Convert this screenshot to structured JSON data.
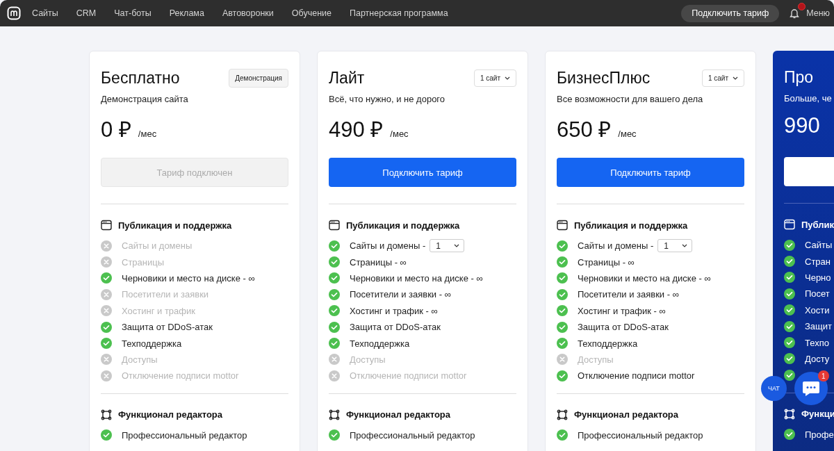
{
  "nav": {
    "items": [
      "Сайты",
      "CRM",
      "Чат-боты",
      "Реклама",
      "Автоворонки",
      "Обучение",
      "Партнерская программа"
    ],
    "cta": "Подключить тариф",
    "notification": true,
    "menu": "Меню"
  },
  "plans": [
    {
      "kind": "standard",
      "title": "Бесплатно",
      "top_control": {
        "kind": "badge",
        "label": "Демонстрация"
      },
      "subtitle": "Демонстрация сайта",
      "price": "0 ₽",
      "period": "/мес",
      "button": {
        "kind": "disabled",
        "label": "Тариф подключен"
      },
      "sections": [
        {
          "title": "Публикация и поддержка",
          "items": [
            {
              "label": "Сайты и домены",
              "included": false
            },
            {
              "label": "Страницы",
              "included": false
            },
            {
              "label": "Черновики и место на диске - ∞",
              "included": true
            },
            {
              "label": "Посетители и заявки",
              "included": false
            },
            {
              "label": "Хостинг и трафик",
              "included": false
            },
            {
              "label": "Защита от DDoS-атак",
              "included": true
            },
            {
              "label": "Техподдержка",
              "included": true
            },
            {
              "label": "Доступы",
              "included": false
            },
            {
              "label": "Отключение подписи mottor",
              "included": false
            }
          ]
        },
        {
          "title": "Функционал редактора",
          "items": [
            {
              "label": "Профессиональный редактор",
              "included": true
            }
          ]
        }
      ]
    },
    {
      "kind": "standard",
      "title": "Лайт",
      "top_control": {
        "kind": "dropdown",
        "label": "1 сайт"
      },
      "subtitle": "Всё, что нужно, и не дорого",
      "price": "490 ₽",
      "period": "/мес",
      "button": {
        "kind": "primary",
        "label": "Подключить тариф"
      },
      "sections": [
        {
          "title": "Публикация и поддержка",
          "items": [
            {
              "label": "Сайты и домены -",
              "included": true,
              "select": "1"
            },
            {
              "label": "Страницы - ∞",
              "included": true
            },
            {
              "label": "Черновики и место на диске - ∞",
              "included": true
            },
            {
              "label": "Посетители и заявки - ∞",
              "included": true
            },
            {
              "label": "Хостинг и трафик - ∞",
              "included": true
            },
            {
              "label": "Защита от DDoS-атак",
              "included": true
            },
            {
              "label": "Техподдержка",
              "included": true
            },
            {
              "label": "Доступы",
              "included": false
            },
            {
              "label": "Отключение подписи mottor",
              "included": false
            }
          ]
        },
        {
          "title": "Функционал редактора",
          "items": [
            {
              "label": "Профессиональный редактор",
              "included": true
            }
          ]
        }
      ]
    },
    {
      "kind": "standard",
      "title": "БизнесПлюс",
      "top_control": {
        "kind": "dropdown",
        "label": "1 сайт"
      },
      "subtitle": "Все возможности для вашего дела",
      "price": "650 ₽",
      "period": "/мес",
      "button": {
        "kind": "primary",
        "label": "Подключить тариф"
      },
      "sections": [
        {
          "title": "Публикация и поддержка",
          "items": [
            {
              "label": "Сайты и домены -",
              "included": true,
              "select": "1"
            },
            {
              "label": "Страницы - ∞",
              "included": true
            },
            {
              "label": "Черновики и место на диске - ∞",
              "included": true
            },
            {
              "label": "Посетители и заявки - ∞",
              "included": true
            },
            {
              "label": "Хостинг и трафик - ∞",
              "included": true
            },
            {
              "label": "Защита от DDoS-атак",
              "included": true
            },
            {
              "label": "Техподдержка",
              "included": true
            },
            {
              "label": "Доступы",
              "included": false
            },
            {
              "label": "Отключение подписи mottor",
              "included": true
            }
          ]
        },
        {
          "title": "Функционал редактора",
          "items": [
            {
              "label": "Профессиональный редактор",
              "included": true
            }
          ]
        }
      ]
    },
    {
      "kind": "featured",
      "title": "Про",
      "subtitle": "Больше, че",
      "price": "990",
      "button": {
        "kind": "inverse"
      },
      "sections": [
        {
          "title": "Публик",
          "items": [
            {
              "label": "Сайты",
              "included": true
            },
            {
              "label": "Стран",
              "included": true
            },
            {
              "label": "Черно",
              "included": true
            },
            {
              "label": "Посет",
              "included": true
            },
            {
              "label": "Хости",
              "included": true
            },
            {
              "label": "Защит",
              "included": true
            },
            {
              "label": "Техпо",
              "included": true
            },
            {
              "label": "Досту",
              "included": true
            },
            {
              "included": true
            }
          ]
        },
        {
          "title": "Функци",
          "items": [
            {
              "label": "Профе",
              "included": true
            }
          ]
        }
      ]
    }
  ],
  "chat": {
    "label": "ЧАТ",
    "badge": "1"
  }
}
